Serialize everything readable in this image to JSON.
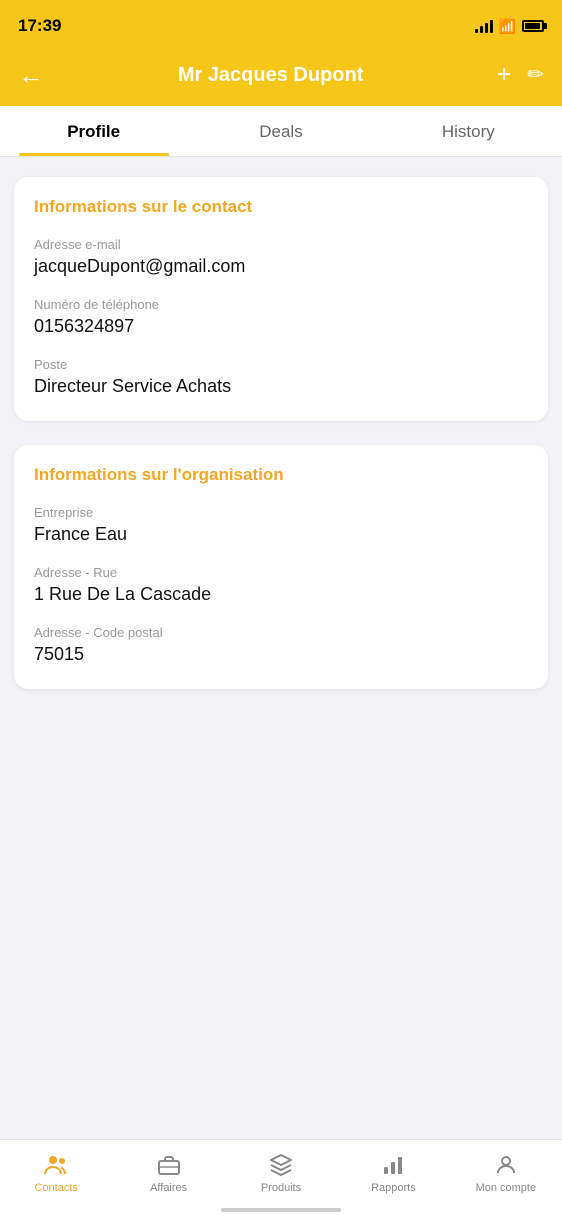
{
  "statusBar": {
    "time": "17:39"
  },
  "header": {
    "title": "Mr Jacques Dupont",
    "back_label": "←",
    "add_label": "+",
    "edit_label": "✏"
  },
  "tabs": [
    {
      "id": "profile",
      "label": "Profile",
      "active": true
    },
    {
      "id": "deals",
      "label": "Deals",
      "active": false
    },
    {
      "id": "history",
      "label": "History",
      "active": false
    }
  ],
  "contactSection": {
    "title": "Informations sur le contact",
    "fields": [
      {
        "label": "Adresse e-mail",
        "value": "jacqueDupont@gmail.com"
      },
      {
        "label": "Numéro de téléphone",
        "value": "0156324897"
      },
      {
        "label": "Poste",
        "value": "Directeur Service Achats"
      }
    ]
  },
  "orgSection": {
    "title": "Informations sur l'organisation",
    "fields": [
      {
        "label": "Entreprise",
        "value": "France Eau"
      },
      {
        "label": "Adresse - Rue",
        "value": "1 Rue De La Cascade"
      },
      {
        "label": "Adresse - Code postal",
        "value": "75015"
      }
    ]
  },
  "bottomNav": [
    {
      "id": "contacts",
      "label": "Contacts",
      "active": true,
      "icon": "contacts"
    },
    {
      "id": "affaires",
      "label": "Affaires",
      "active": false,
      "icon": "briefcase"
    },
    {
      "id": "produits",
      "label": "Produits",
      "active": false,
      "icon": "cube"
    },
    {
      "id": "rapports",
      "label": "Rapports",
      "active": false,
      "icon": "chart"
    },
    {
      "id": "moncompte",
      "label": "Mon compte",
      "active": false,
      "icon": "account"
    }
  ]
}
